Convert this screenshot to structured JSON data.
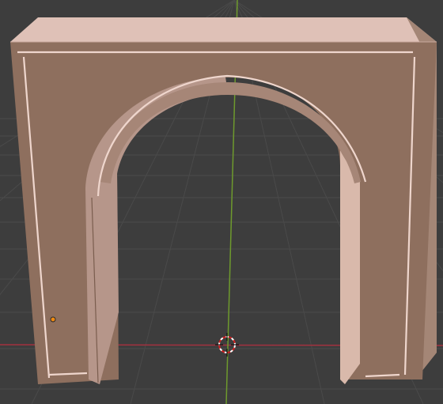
{
  "viewport": {
    "background": "#3d3d3d",
    "grid_color": "#4a4a4a",
    "x_axis_color": "#a3313f",
    "y_axis_color": "#6e9a2d"
  },
  "object": {
    "name": "arch",
    "face_color": "#8e6f5e",
    "top_color": "#dfc1b7",
    "inner_light": "#d9b9ab",
    "inner_dark": "#b6968a",
    "edge_highlight": "#efd6cd",
    "origin_color": "#f08a12"
  },
  "icons": {
    "origin": "object-origin-dot",
    "cursor": "3d-cursor-icon"
  }
}
